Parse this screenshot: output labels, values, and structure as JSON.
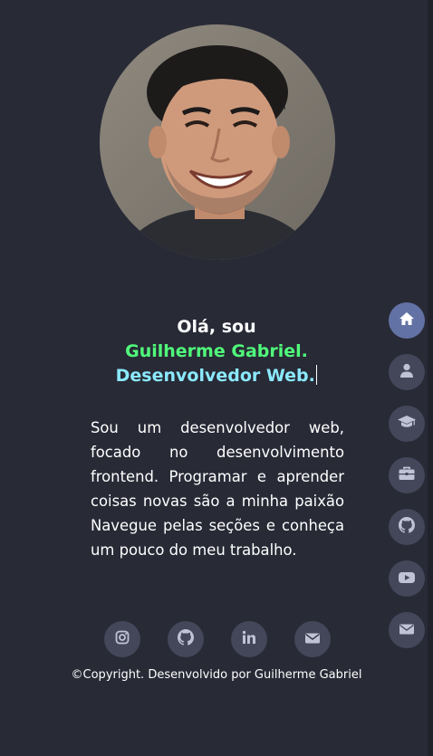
{
  "colors": {
    "background": "#282a36",
    "name": "#50fa7b",
    "role": "#8be9fd",
    "button": "#44475a",
    "active_button": "#6272a4",
    "icon": "#bfc3d4"
  },
  "hero": {
    "greeting": "Olá, sou",
    "name": "Guilherme Gabriel.",
    "role": "Desenvolvedor Web."
  },
  "about": {
    "text": "Sou um desenvolvedor web, focado no desenvolvimento frontend. Programar e aprender coisas novas são a minha paixão Navegue pelas seções e conheça um pouco do meu trabalho."
  },
  "social": [
    {
      "icon": "instagram-icon"
    },
    {
      "icon": "github-icon"
    },
    {
      "icon": "linkedin-icon"
    },
    {
      "icon": "email-icon"
    }
  ],
  "footer": {
    "copyright": "©Copyright. Desenvolvido por Guilherme Gabriel"
  },
  "side_nav": [
    {
      "icon": "home-icon",
      "active": true
    },
    {
      "icon": "user-icon",
      "active": false
    },
    {
      "icon": "graduation-cap-icon",
      "active": false
    },
    {
      "icon": "briefcase-icon",
      "active": false
    },
    {
      "icon": "github-icon",
      "active": false
    },
    {
      "icon": "youtube-icon",
      "active": false
    },
    {
      "icon": "email-icon",
      "active": false
    }
  ]
}
